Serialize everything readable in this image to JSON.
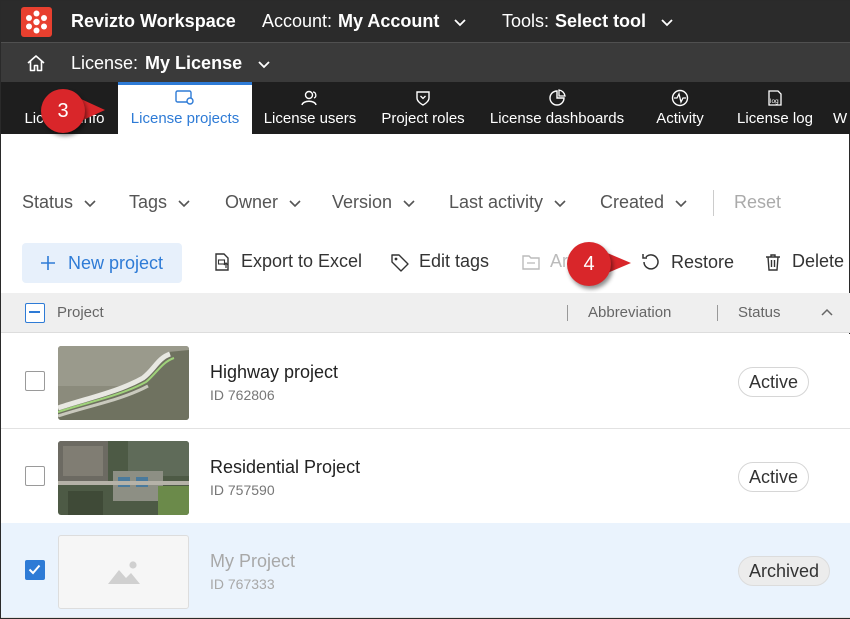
{
  "app": {
    "title": "Revizto Workspace",
    "account_key": "Account:",
    "account_value": "My Account",
    "tools_key": "Tools:",
    "tools_value": "Select tool",
    "brand_color": "#e8402f"
  },
  "license_bar": {
    "key": "License:",
    "value": "My License"
  },
  "tabs": [
    {
      "label": "License info",
      "icon": "info-icon"
    },
    {
      "label": "License projects",
      "icon": "projects-gear-icon",
      "active": true
    },
    {
      "label": "License users",
      "icon": "users-icon"
    },
    {
      "label": "Project roles",
      "icon": "shield-icon"
    },
    {
      "label": "License dashboards",
      "icon": "pie-chart-icon"
    },
    {
      "label": "Activity",
      "icon": "activity-icon"
    },
    {
      "label": "License log",
      "icon": "log-icon"
    },
    {
      "label": "W",
      "icon": "more-icon"
    }
  ],
  "callouts": {
    "first": "3",
    "second": "4"
  },
  "filters": {
    "items": [
      "Status",
      "Tags",
      "Owner",
      "Version",
      "Last activity",
      "Created"
    ],
    "reset": "Reset"
  },
  "actions": {
    "new_project": "New project",
    "export": "Export to Excel",
    "edit_tags": "Edit tags",
    "archive": "Ar",
    "restore": "Restore",
    "delete": "Delete"
  },
  "table": {
    "columns": [
      "Project",
      "Abbreviation",
      "Status"
    ],
    "rows": [
      {
        "name": "Highway project",
        "id": "ID 762806",
        "status": "Active",
        "selected": false
      },
      {
        "name": "Residential Project",
        "id": "ID 757590",
        "status": "Active",
        "selected": false
      },
      {
        "name": "My Project",
        "id": "ID 767333",
        "status": "Archived",
        "selected": true
      }
    ]
  },
  "colors": {
    "accent": "#2e7bd6",
    "callout": "#d9262a",
    "topbar": "#2b2b2b"
  }
}
